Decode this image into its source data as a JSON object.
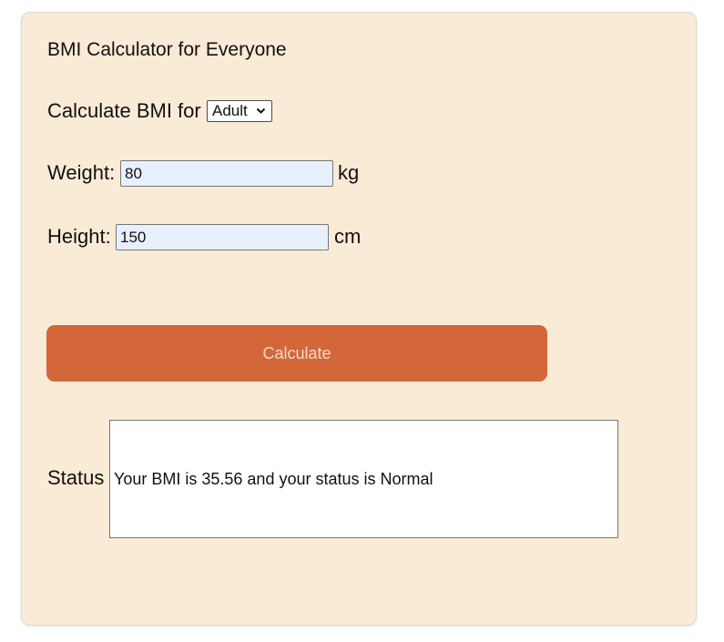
{
  "app": {
    "title": "BMI Calculator for Everyone"
  },
  "form": {
    "calculate_for_label": "Calculate BMI for",
    "calculate_for_selected": "Adult",
    "weight_label": "Weight:",
    "weight_value": "80",
    "weight_unit": "kg",
    "height_label": "Height:",
    "height_value": "150",
    "height_unit": "cm",
    "calculate_button_label": "Calculate"
  },
  "status": {
    "label": "Status",
    "message": "Your BMI is 35.56 and your status is Normal"
  },
  "colors": {
    "card_background": "#faebd7",
    "button_background": "#d4673a",
    "input_autofill_background": "#e8f0fe"
  },
  "icons": {
    "select_chevron": "chevron-down-icon"
  }
}
